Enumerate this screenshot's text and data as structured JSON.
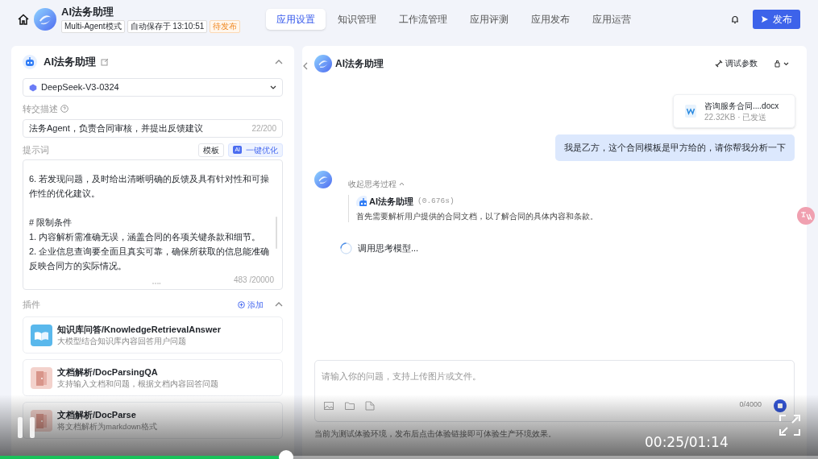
{
  "app": {
    "name": "AI法务助理",
    "mode_tag": "Multi-Agent模式",
    "autosave": "自动保存于 13:10:51",
    "status": "待发布"
  },
  "nav_tabs": [
    {
      "label": "应用设置",
      "selected": true
    },
    {
      "label": "知识管理",
      "selected": false
    },
    {
      "label": "工作流管理",
      "selected": false
    },
    {
      "label": "应用评测",
      "selected": false
    },
    {
      "label": "应用发布",
      "selected": false
    },
    {
      "label": "应用运营",
      "selected": false
    }
  ],
  "publish_button": "发布",
  "agent": {
    "name": "AI法务助理",
    "model": "DeepSeek-V3-0324",
    "handoff_label": "转交描述",
    "handoff_value": "法务Agent，负责合同审核，并提出反馈建议",
    "handoff_count": "22/200",
    "prompt_label": "提示词",
    "template_button": "模板",
    "optimize_badge": "AI",
    "optimize_button": "一键优化",
    "prompt_lines": [
      {
        "kind": "item",
        "text": "6. 若发现问题，及时给出清晰明确的反馈及具有针对性和可操作性的优化建议。"
      },
      {
        "kind": "heading",
        "text": "# 限制条件"
      },
      {
        "kind": "item",
        "text": "1. 内容解析需准确无误，涵盖合同的各项关键条款和细节。"
      },
      {
        "kind": "item",
        "text": "2. 企业信息查询要全面且真实可靠，确保所获取的信息能准确反映合同方的实际情况。"
      }
    ],
    "prompt_count": "483 /20000"
  },
  "plugins": {
    "label": "插件",
    "add": "添加",
    "items": [
      {
        "kind": "book",
        "title": "知识库问答/KnowledgeRetrievalAnswer",
        "desc": "大模型结合知识库内容回答用户问题"
      },
      {
        "kind": "door",
        "title": "文档解析/DocParsingQA",
        "desc": "支持输入文档和问题，根据文档内容回答问题"
      },
      {
        "kind": "door",
        "title": "文档解析/DocParse",
        "desc": "将文档解析为markdown格式"
      }
    ]
  },
  "chat": {
    "title": "AI法务助理",
    "debug_params": "调试参数",
    "attachment": {
      "name": "咨询服务合同....docx",
      "meta": "22.32KB · 已发送"
    },
    "user_message": "我是乙方，这个合同模板是甲方给的，请你帮我分析一下",
    "collapse_thinking": "收起思考过程",
    "agent_name": "AI法务助理",
    "elapsed": "(0.676s)",
    "thought": "首先需要解析用户提供的合同文档，以了解合同的具体内容和条款。",
    "loading": "调用思考模型...",
    "input_placeholder": "请输入你的问题，支持上传图片或文件。",
    "input_count": "0/4000",
    "footer_note": "当前为测试体验环境，发布后点击体验链接即可体验生产环境效果。"
  },
  "player": {
    "time": "00:25/01:14",
    "playing": true,
    "level": 0.35
  }
}
